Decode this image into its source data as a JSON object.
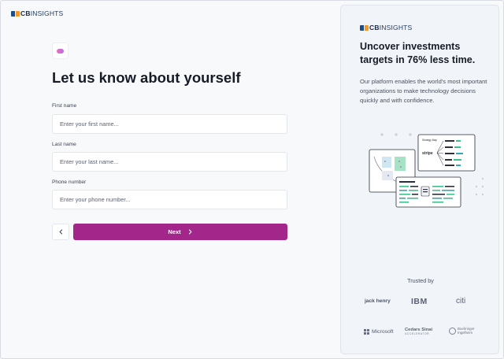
{
  "brand": {
    "logo_bold": "CB",
    "logo_light": "INSIGHTS"
  },
  "form": {
    "title": "Let us know about yourself",
    "first_name": {
      "label": "First name",
      "placeholder": "Enter your first name..."
    },
    "last_name": {
      "label": "Last name",
      "placeholder": "Enter your last name..."
    },
    "phone": {
      "label": "Phone number",
      "placeholder": "Enter your phone number..."
    },
    "next_label": "Next"
  },
  "panel": {
    "heading": "Uncover investments targets in 76% less time.",
    "body": "Our platform enables the world's most important organizations to make technology decisions quickly and with confidence.",
    "trusted_label": "Trusted by",
    "logos": {
      "jack_henry": "jack henry",
      "ibm": "IBM",
      "citi": "citi",
      "microsoft": "Microsoft",
      "cedars_1": "Cedars Sinai",
      "cedars_2": "ACCELERATOR",
      "boehringer_1": "Boehringer",
      "boehringer_2": "Ingelheim"
    },
    "illustration": {
      "card_title": "Strategy Map",
      "stripe": "stripe"
    }
  },
  "colors": {
    "accent": "#a3268a",
    "logo_blue": "#1d4e89",
    "logo_orange": "#f39a2b"
  },
  "icons": {
    "back": "chevron-left-icon",
    "next": "chevron-right-icon",
    "app": "app-badge-icon"
  }
}
